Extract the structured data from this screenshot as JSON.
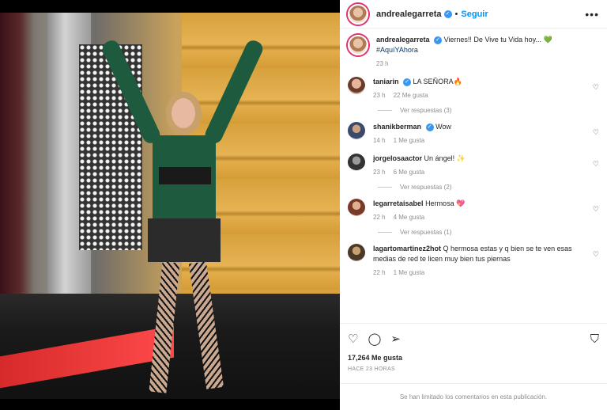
{
  "post": {
    "author": "andrealegarreta",
    "follow_label": "Seguir",
    "more_label": "•••",
    "caption_text": "Viernes!! De Vive tu Vida hoy... 💚",
    "caption_hashtag": "#AquíYAhora",
    "caption_time": "23 h",
    "likes": "17,264 Me gusta",
    "date": "HACE 23 HORAS",
    "comments_limited": "Se han limitado los comentarios en esta publicación."
  },
  "comments": [
    {
      "user": "taniarin",
      "verified": true,
      "text": "LA SEÑORA🔥",
      "time": "23 h",
      "likes": "22 Me gusta",
      "replies": "Ver respuestas (3)"
    },
    {
      "user": "shanikberman",
      "verified": true,
      "text": "Wow",
      "time": "14 h",
      "likes": "1 Me gusta",
      "replies": ""
    },
    {
      "user": "jorgelosaactor",
      "verified": false,
      "text": "Un ángel! ✨",
      "time": "23 h",
      "likes": "6 Me gusta",
      "replies": "Ver respuestas (2)"
    },
    {
      "user": "legarretaisabel",
      "verified": false,
      "text": "Hermosa 💖",
      "time": "22 h",
      "likes": "4 Me gusta",
      "replies": "Ver respuestas (1)"
    },
    {
      "user": "lagartomartinez2hot",
      "verified": false,
      "text": "Q hermosa estas y q bien se te ven esas medias de red te licen muy bien tus piernas",
      "time": "22 h",
      "likes": "1 Me gusta",
      "replies": ""
    }
  ],
  "icons": {
    "like": "heart-icon",
    "comment": "comment-icon",
    "share": "send-icon",
    "save": "bookmark-icon",
    "verified": "verified-badge-icon",
    "more": "more-icon"
  },
  "colors": {
    "accent": "#0095f6",
    "verified": "#3897f0",
    "muted": "#8e8e8e"
  }
}
